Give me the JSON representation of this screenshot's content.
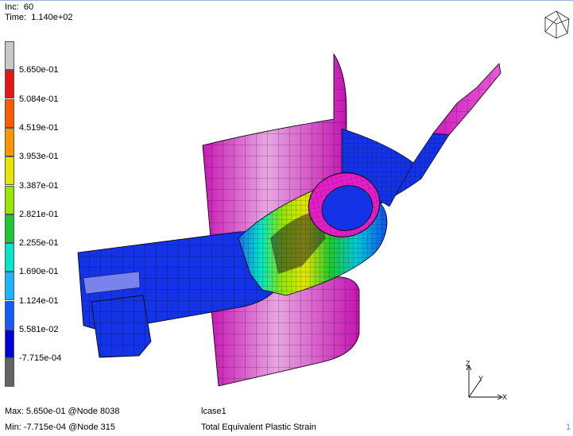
{
  "header": {
    "inc_label": "Inc:",
    "inc_value": "60",
    "time_label": "Time:",
    "time_value": "1.140e+02"
  },
  "legend": {
    "labels": [
      "5.650e-01",
      "5.084e-01",
      "4.519e-01",
      "3.953e-01",
      "3.387e-01",
      "2.821e-01",
      "2.255e-01",
      "1.690e-01",
      "1.124e-01",
      "5.581e-02",
      "-7.715e-04"
    ],
    "colors": [
      "#c8c8c8",
      "#e81414",
      "#ff5a00",
      "#ff9600",
      "#e6e600",
      "#96e600",
      "#1ec832",
      "#00e6c8",
      "#1eb4ff",
      "#145aff",
      "#0000dc",
      "#646464"
    ]
  },
  "footer": {
    "max_text": "Max:  5.650e-01 @Node  8038",
    "min_text": "Min: -7.715e-04 @Node  315",
    "loadcase": "lcase1",
    "result_name": "Total Equivalent Plastic Strain",
    "page_marker": "1"
  },
  "triad": {
    "x_label": "X",
    "y_label": "Y",
    "z_label": "Z"
  },
  "colors": {
    "magenta": "#e61ec8",
    "blue": "#1432e6",
    "navy_edge": "#000050"
  }
}
